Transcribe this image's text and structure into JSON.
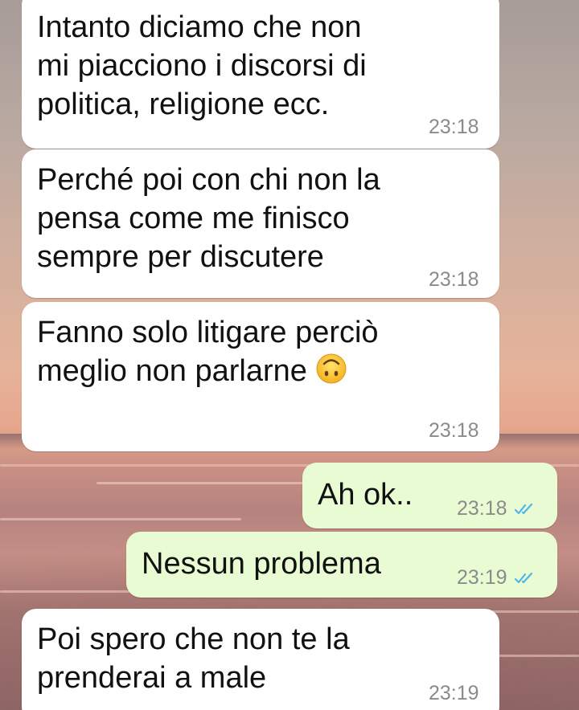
{
  "messages": [
    {
      "direction": "incoming",
      "text": "Intanto diciamo che non\nmi piacciono i discorsi di\npolitica, religione ecc.",
      "time": "23:18"
    },
    {
      "direction": "incoming",
      "text": "Perché poi con chi non la\npensa come me finisco\nsempre per discutere",
      "time": "23:18"
    },
    {
      "direction": "incoming",
      "text": "Fanno solo litigare perciò\nmeglio non parlarne",
      "emoji": "upside-down-face",
      "time": "23:18"
    },
    {
      "direction": "outgoing",
      "text": "Ah ok..",
      "time": "23:18",
      "status": "read"
    },
    {
      "direction": "outgoing",
      "text": "Nessun problema",
      "time": "23:19",
      "status": "read"
    },
    {
      "direction": "incoming",
      "text": "Poi spero che non te la\nprenderai a male",
      "time": "23:19"
    }
  ],
  "colors": {
    "incoming_bubble": "#ffffff",
    "outgoing_bubble": "#e8fbd3",
    "read_tick": "#4fb6ec",
    "timestamp": "#8b8b8b"
  }
}
